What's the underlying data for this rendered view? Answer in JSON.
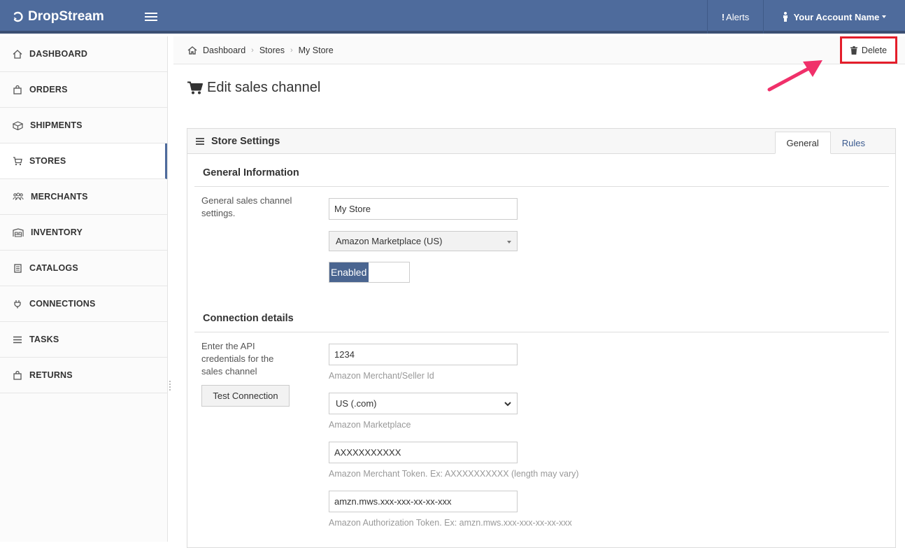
{
  "header": {
    "brand": "DropStream",
    "alerts_label": "Alerts",
    "account_label": "Your Account Name"
  },
  "sidebar": {
    "items": [
      {
        "label": "DASHBOARD",
        "icon": "home-icon"
      },
      {
        "label": "ORDERS",
        "icon": "bag-icon"
      },
      {
        "label": "SHIPMENTS",
        "icon": "box-icon"
      },
      {
        "label": "STORES",
        "icon": "cart-icon"
      },
      {
        "label": "MERCHANTS",
        "icon": "users-icon"
      },
      {
        "label": "INVENTORY",
        "icon": "warehouse-icon"
      },
      {
        "label": "CATALOGS",
        "icon": "book-icon"
      },
      {
        "label": "CONNECTIONS",
        "icon": "plug-icon"
      },
      {
        "label": "TASKS",
        "icon": "list-icon"
      },
      {
        "label": "RETURNS",
        "icon": "bag-icon"
      }
    ],
    "active": "STORES"
  },
  "breadcrumb": {
    "items": [
      "Dashboard",
      "Stores",
      "My Store"
    ],
    "delete_label": "Delete"
  },
  "page": {
    "title": "Edit sales channel"
  },
  "panel": {
    "title": "Store Settings",
    "tabs": [
      "General",
      "Rules"
    ],
    "active_tab": "General",
    "general": {
      "title": "General Information",
      "description": "General sales channel settings.",
      "store_name": "My Store",
      "channel_type": "Amazon Marketplace (US)",
      "status_label": "Enabled"
    },
    "connection": {
      "title": "Connection details",
      "description": "Enter the API credentials for the sales channel",
      "test_button": "Test Connection",
      "merchant_id": "1234",
      "merchant_id_help": "Amazon Merchant/Seller Id",
      "marketplace": "US (.com)",
      "marketplace_help": "Amazon Marketplace",
      "merchant_token": "AXXXXXXXXXX",
      "merchant_token_help": "Amazon Merchant Token. Ex: AXXXXXXXXXX (length may vary)",
      "auth_token": "amzn.mws.xxx-xxx-xx-xx-xxx",
      "auth_token_help": "Amazon Authorization Token. Ex: amzn.mws.xxx-xxx-xx-xx-xxx"
    }
  },
  "colors": {
    "header_bg": "#4e6b9c",
    "accent": "#4a6590",
    "highlight": "#e41e2b",
    "arrow": "#f0306a"
  }
}
